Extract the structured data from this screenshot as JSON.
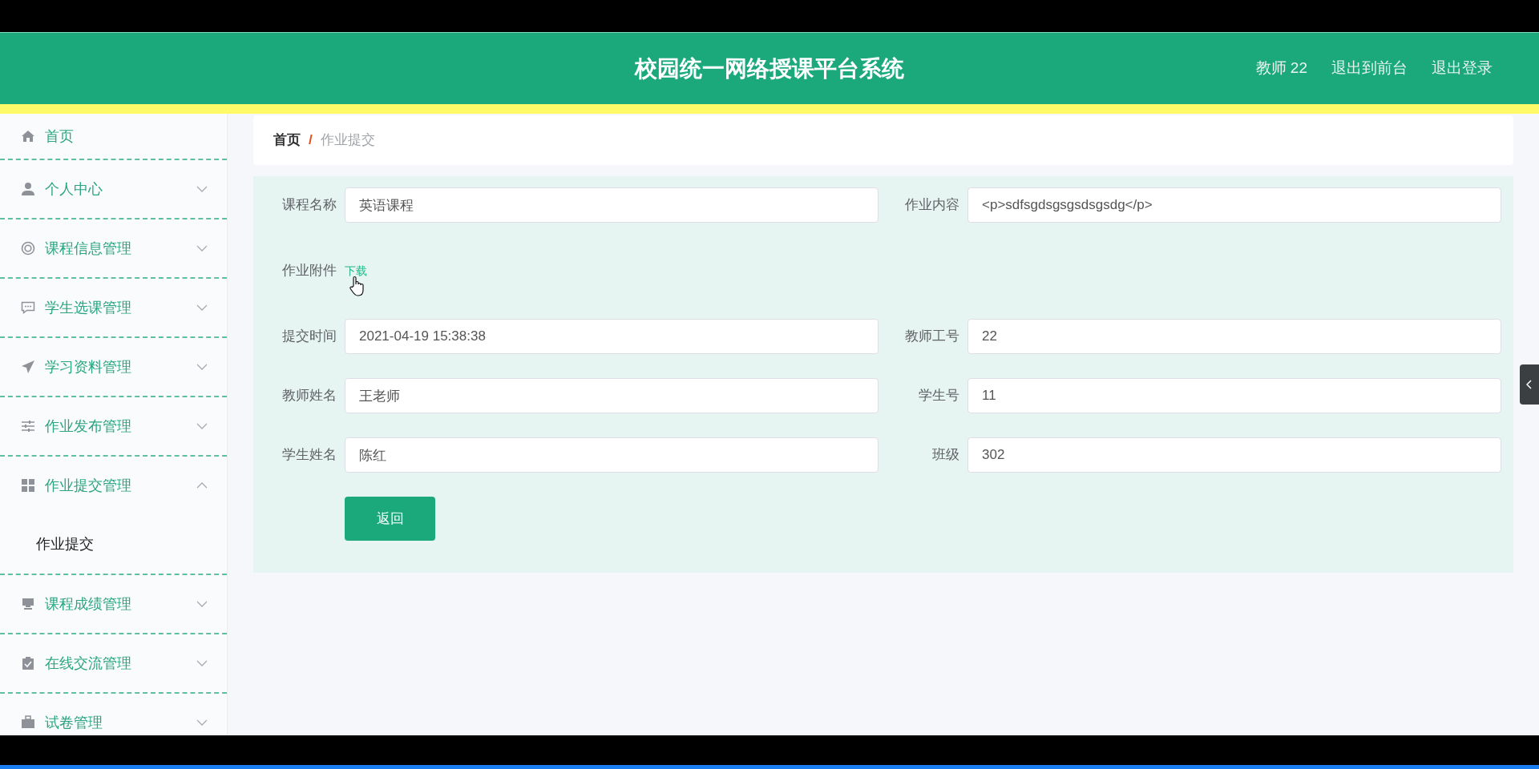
{
  "header": {
    "title": "校园统一网络授课平台系统",
    "links": [
      "教师 22",
      "退出到前台",
      "退出登录"
    ]
  },
  "sidebar": {
    "items": [
      {
        "label": "首页"
      },
      {
        "label": "个人中心",
        "expanded": false
      },
      {
        "label": "课程信息管理",
        "expanded": false
      },
      {
        "label": "学生选课管理",
        "expanded": false
      },
      {
        "label": "学习资料管理",
        "expanded": false
      },
      {
        "label": "作业发布管理",
        "expanded": false
      },
      {
        "label": "作业提交管理",
        "expanded": true,
        "children": [
          {
            "label": "作业提交"
          }
        ]
      },
      {
        "label": "课程成绩管理",
        "expanded": false
      },
      {
        "label": "在线交流管理",
        "expanded": false
      },
      {
        "label": "试卷管理",
        "expanded": false
      }
    ]
  },
  "breadcrumb": {
    "home": "首页",
    "separator": "/",
    "current": "作业提交"
  },
  "form": {
    "rows": [
      [
        {
          "kind": "input",
          "label": "课程名称",
          "value": "英语课程"
        },
        {
          "kind": "input",
          "label": "作业内容",
          "value": "<p>sdfsgdsgsgsdsgsdg</p>"
        }
      ],
      [
        {
          "kind": "link",
          "label": "作业附件",
          "value": "下载"
        }
      ],
      [
        {
          "kind": "input",
          "label": "提交时间",
          "value": "2021-04-19 15:38:38"
        },
        {
          "kind": "input",
          "label": "教师工号",
          "value": "22"
        }
      ],
      [
        {
          "kind": "input",
          "label": "教师姓名",
          "value": "王老师"
        },
        {
          "kind": "input",
          "label": "学生号",
          "value": "11"
        }
      ],
      [
        {
          "kind": "input",
          "label": "学生姓名",
          "value": "陈红"
        },
        {
          "kind": "input",
          "label": "班级",
          "value": "302"
        }
      ]
    ],
    "button": "返回"
  }
}
